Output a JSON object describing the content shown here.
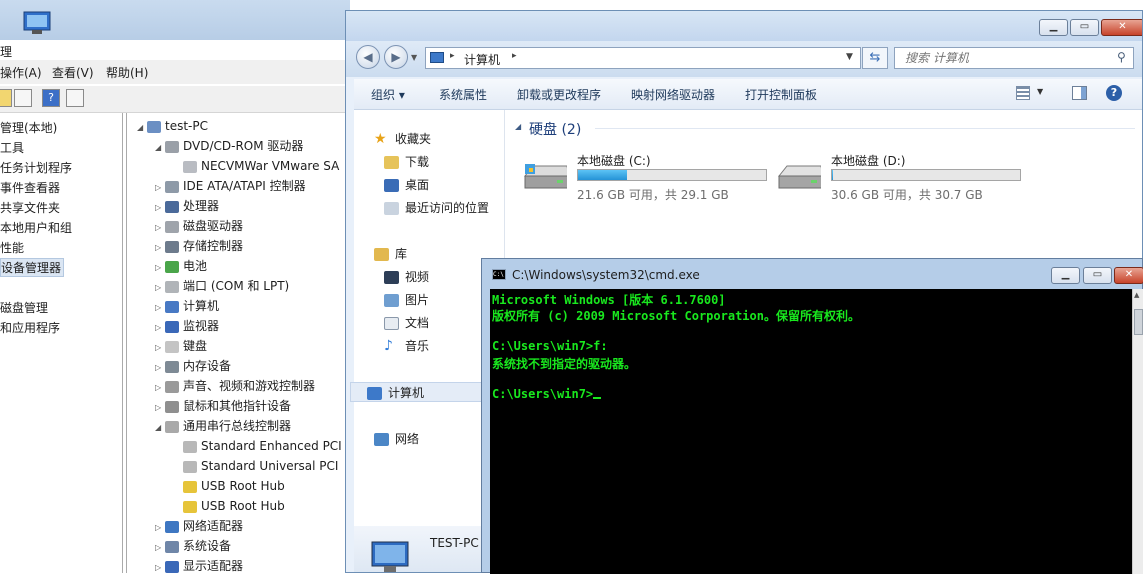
{
  "computer_management": {
    "title": "理",
    "menu": [
      "操作(A)",
      "查看(V)",
      "帮助(H)"
    ],
    "left_tree": [
      "管理(本地)",
      "工具",
      "任务计划程序",
      "事件查看器",
      "共享文件夹",
      "本地用户和组",
      "性能",
      "设备管理器",
      "磁盘管理",
      "和应用程序"
    ],
    "device_tree": [
      {
        "label": "test-PC",
        "expander": "◢"
      },
      {
        "label": "DVD/CD-ROM 驱动器",
        "expander": "◢"
      },
      {
        "label": "NECVMWar VMware SA",
        "expander": ""
      },
      {
        "label": "IDE ATA/ATAPI 控制器",
        "expander": "▷"
      },
      {
        "label": "处理器",
        "expander": "▷"
      },
      {
        "label": "磁盘驱动器",
        "expander": "▷"
      },
      {
        "label": "存储控制器",
        "expander": "▷"
      },
      {
        "label": "电池",
        "expander": "▷"
      },
      {
        "label": "端口 (COM 和 LPT)",
        "expander": "▷"
      },
      {
        "label": "计算机",
        "expander": "▷"
      },
      {
        "label": "监视器",
        "expander": "▷"
      },
      {
        "label": "键盘",
        "expander": "▷"
      },
      {
        "label": "内存设备",
        "expander": "▷"
      },
      {
        "label": "声音、视频和游戏控制器",
        "expander": "▷"
      },
      {
        "label": "鼠标和其他指针设备",
        "expander": "▷"
      },
      {
        "label": "通用串行总线控制器",
        "expander": "◢"
      },
      {
        "label": "Standard Enhanced PCI",
        "expander": ""
      },
      {
        "label": "Standard Universal PCI",
        "expander": ""
      },
      {
        "label": "USB Root Hub",
        "expander": ""
      },
      {
        "label": "USB Root Hub",
        "expander": ""
      },
      {
        "label": "网络适配器",
        "expander": "▷"
      },
      {
        "label": "系统设备",
        "expander": "▷"
      },
      {
        "label": "显示适配器",
        "expander": "▷"
      }
    ]
  },
  "explorer": {
    "breadcrumb": [
      "计算机"
    ],
    "search_placeholder": "搜索 计算机",
    "commands": [
      "组织 ▾",
      "系统属性",
      "卸载或更改程序",
      "映射网络驱动器",
      "打开控制面板"
    ],
    "nav": {
      "favorites": "收藏夹",
      "downloads": "下载",
      "desktop": "桌面",
      "recent": "最近访问的位置",
      "libraries": "库",
      "videos": "视频",
      "pictures": "图片",
      "documents": "文档",
      "music": "音乐",
      "computer": "计算机",
      "network": "网络"
    },
    "group_header": "硬盘 (2)",
    "drives": [
      {
        "name": "本地磁盘 (C:)",
        "info": "21.6 GB 可用，共 29.1 GB",
        "used_fraction": 0.26
      },
      {
        "name": "本地磁盘 (D:)",
        "info": "30.6 GB 可用，共 30.7 GB",
        "used_fraction": 0.003
      }
    ],
    "details_name": "TEST-PC"
  },
  "cmd": {
    "title": "C:\\Windows\\system32\\cmd.exe",
    "lines": [
      "Microsoft Windows [版本 6.1.7600]",
      "版权所有 (c) 2009 Microsoft Corporation。保留所有权利。",
      "",
      "C:\\Users\\win7>f:",
      "系统找不到指定的驱动器。",
      "",
      "C:\\Users\\win7>"
    ]
  },
  "colors": {
    "console_text": "#19e81e",
    "console_bg": "#000000",
    "command_bar_text": "#1e395b",
    "drive_bar_fill": "#2593d6"
  }
}
